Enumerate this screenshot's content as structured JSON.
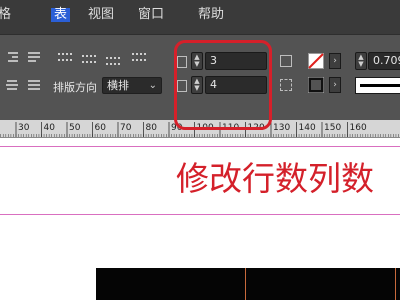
{
  "menubar": {
    "items": [
      {
        "label": "格"
      },
      {
        "label": "表",
        "active": true
      },
      {
        "label": "视图"
      },
      {
        "label": "窗口"
      },
      {
        "label": "帮助"
      }
    ]
  },
  "panel": {
    "direction_label": "排版方向",
    "direction_value": "横排",
    "rows_value": "3",
    "columns_value": "4",
    "stroke_weight_value": "0.709"
  },
  "ruler": {
    "ticks": [
      "30",
      "40",
      "50",
      "60",
      "70",
      "80",
      "90",
      "100",
      "110",
      "120",
      "130",
      "140",
      "150",
      "160"
    ]
  },
  "annotation": {
    "text": "修改行数列数"
  },
  "colors": {
    "highlight": "#d6202a",
    "annotation": "#d4202a",
    "menubar": "#3a3a3a",
    "panel": "#535353",
    "guide": "#d96fc0"
  }
}
